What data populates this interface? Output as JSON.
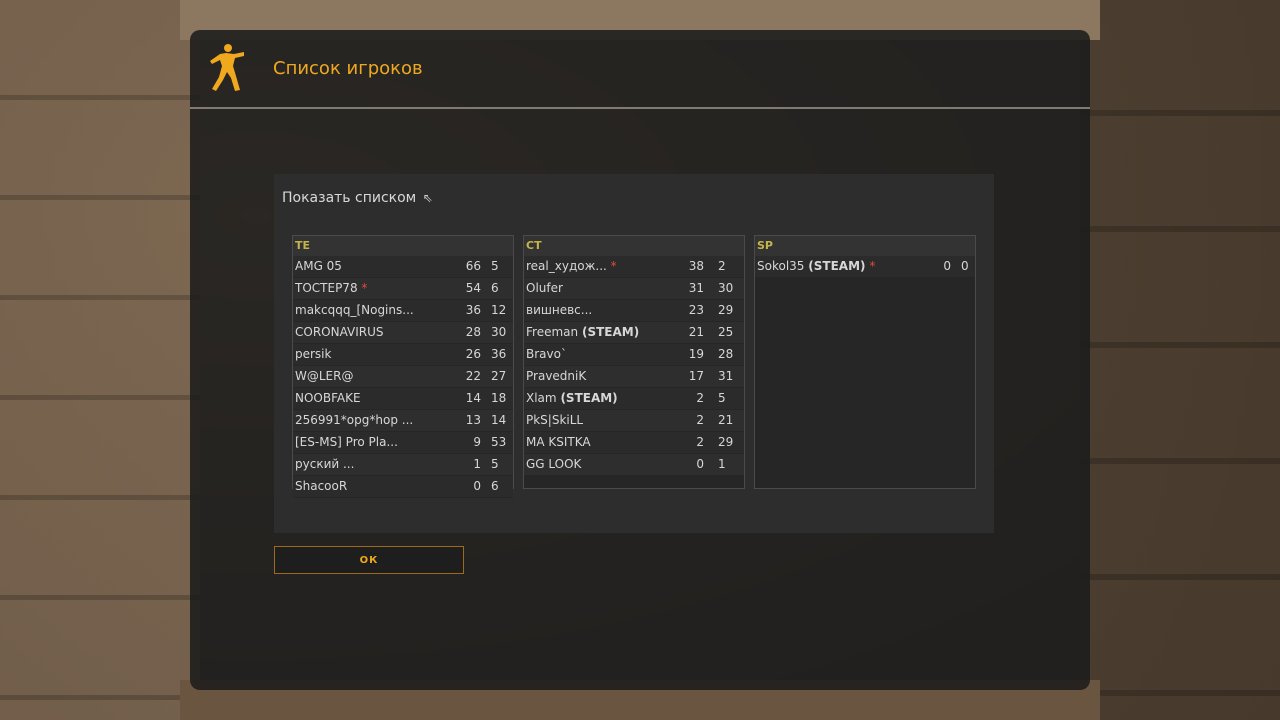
{
  "dialog": {
    "title": "Список игроков",
    "view_toggle_label": "Показать списком",
    "view_toggle_icon": "collapse-arrow-icon",
    "ok_label": "ОК"
  },
  "colors": {
    "accent": "#f0a81e",
    "team_header": "#c4b54a",
    "star": "#e24b3b"
  },
  "teams": [
    {
      "name": "TE",
      "players": [
        {
          "name": "AMG 05",
          "tag": "",
          "star": false,
          "kills": "66",
          "deaths": "5"
        },
        {
          "name": "ТОСТЕР78",
          "tag": "",
          "star": true,
          "kills": "54",
          "deaths": "6"
        },
        {
          "name": "makcqqq_[Nogins...",
          "tag": "",
          "star": false,
          "kills": "36",
          "deaths": "12"
        },
        {
          "name": "CORONAVIRUS",
          "tag": "",
          "star": false,
          "kills": "28",
          "deaths": "30"
        },
        {
          "name": "persik",
          "tag": "",
          "star": false,
          "kills": "26",
          "deaths": "36"
        },
        {
          "name": "W@LER@",
          "tag": "",
          "star": false,
          "kills": "22",
          "deaths": "27"
        },
        {
          "name": "NOOBFAKE",
          "tag": "",
          "star": false,
          "kills": "14",
          "deaths": "18"
        },
        {
          "name": "256991*opg*hop ...",
          "tag": "",
          "star": false,
          "kills": "13",
          "deaths": "14"
        },
        {
          "name": "[ES-MS] Pro Pla...",
          "tag": "",
          "star": false,
          "kills": "9",
          "deaths": "53"
        },
        {
          "name": "руский ...",
          "tag": "",
          "star": false,
          "kills": "1",
          "deaths": "5"
        },
        {
          "name": "ShacooR",
          "tag": "",
          "star": false,
          "kills": "0",
          "deaths": "6"
        }
      ]
    },
    {
      "name": "CT",
      "players": [
        {
          "name": "real_худож...",
          "tag": "",
          "star": true,
          "kills": "38",
          "deaths": "2"
        },
        {
          "name": "Olufer",
          "tag": "",
          "star": false,
          "kills": "31",
          "deaths": "30"
        },
        {
          "name": "вишневс...",
          "tag": "",
          "star": false,
          "kills": "23",
          "deaths": "29"
        },
        {
          "name": "Freeman",
          "tag": "(STEAM)",
          "star": false,
          "kills": "21",
          "deaths": "25"
        },
        {
          "name": "Bravo`",
          "tag": "",
          "star": false,
          "kills": "19",
          "deaths": "28"
        },
        {
          "name": "PravedniK",
          "tag": "",
          "star": false,
          "kills": "17",
          "deaths": "31"
        },
        {
          "name": "Xlam",
          "tag": "(STEAM)",
          "star": false,
          "kills": "2",
          "deaths": "5"
        },
        {
          "name": "PkS|SkiLL",
          "tag": "",
          "star": false,
          "kills": "2",
          "deaths": "21"
        },
        {
          "name": "MA KSITKA",
          "tag": "",
          "star": false,
          "kills": "2",
          "deaths": "29"
        },
        {
          "name": "GG LOOK",
          "tag": "",
          "star": false,
          "kills": "0",
          "deaths": "1"
        }
      ]
    },
    {
      "name": "SP",
      "players": [
        {
          "name": "Sokol35",
          "tag": "(STEAM)",
          "star": true,
          "kills": "0",
          "deaths": "0"
        }
      ]
    }
  ]
}
